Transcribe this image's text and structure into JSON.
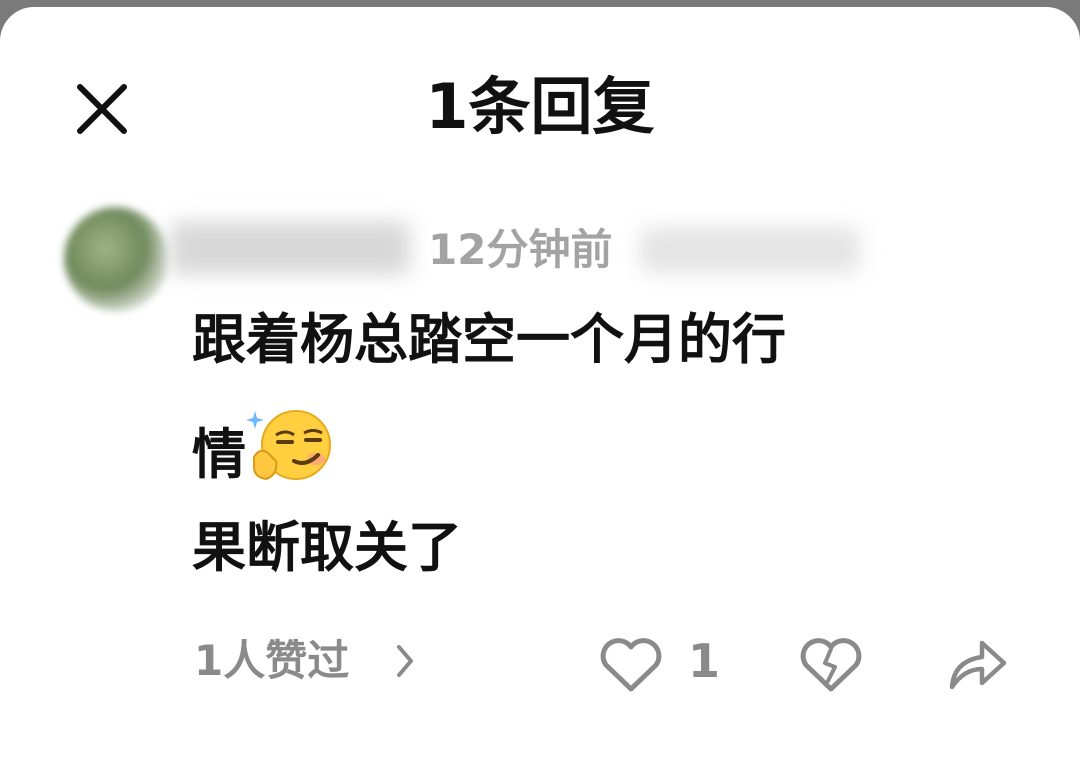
{
  "header": {
    "title": "1条回复",
    "close_icon": "close-icon"
  },
  "comment": {
    "time": "12分钟前",
    "lines": [
      "跟着杨总踏空一个月的行",
      "情",
      "果断取关了"
    ],
    "emoji": "smirk-thinking-emoji"
  },
  "actions": {
    "likes_link": "1人赞过",
    "chevron_icon": "chevron-right-icon",
    "like_icon": "heart-icon",
    "like_count": "1",
    "dislike_icon": "broken-heart-icon",
    "share_icon": "share-icon"
  },
  "colors": {
    "text": "#111111",
    "muted": "#8a8a8a",
    "time": "#a3a3a3",
    "backdrop": "#7a7a7a"
  }
}
